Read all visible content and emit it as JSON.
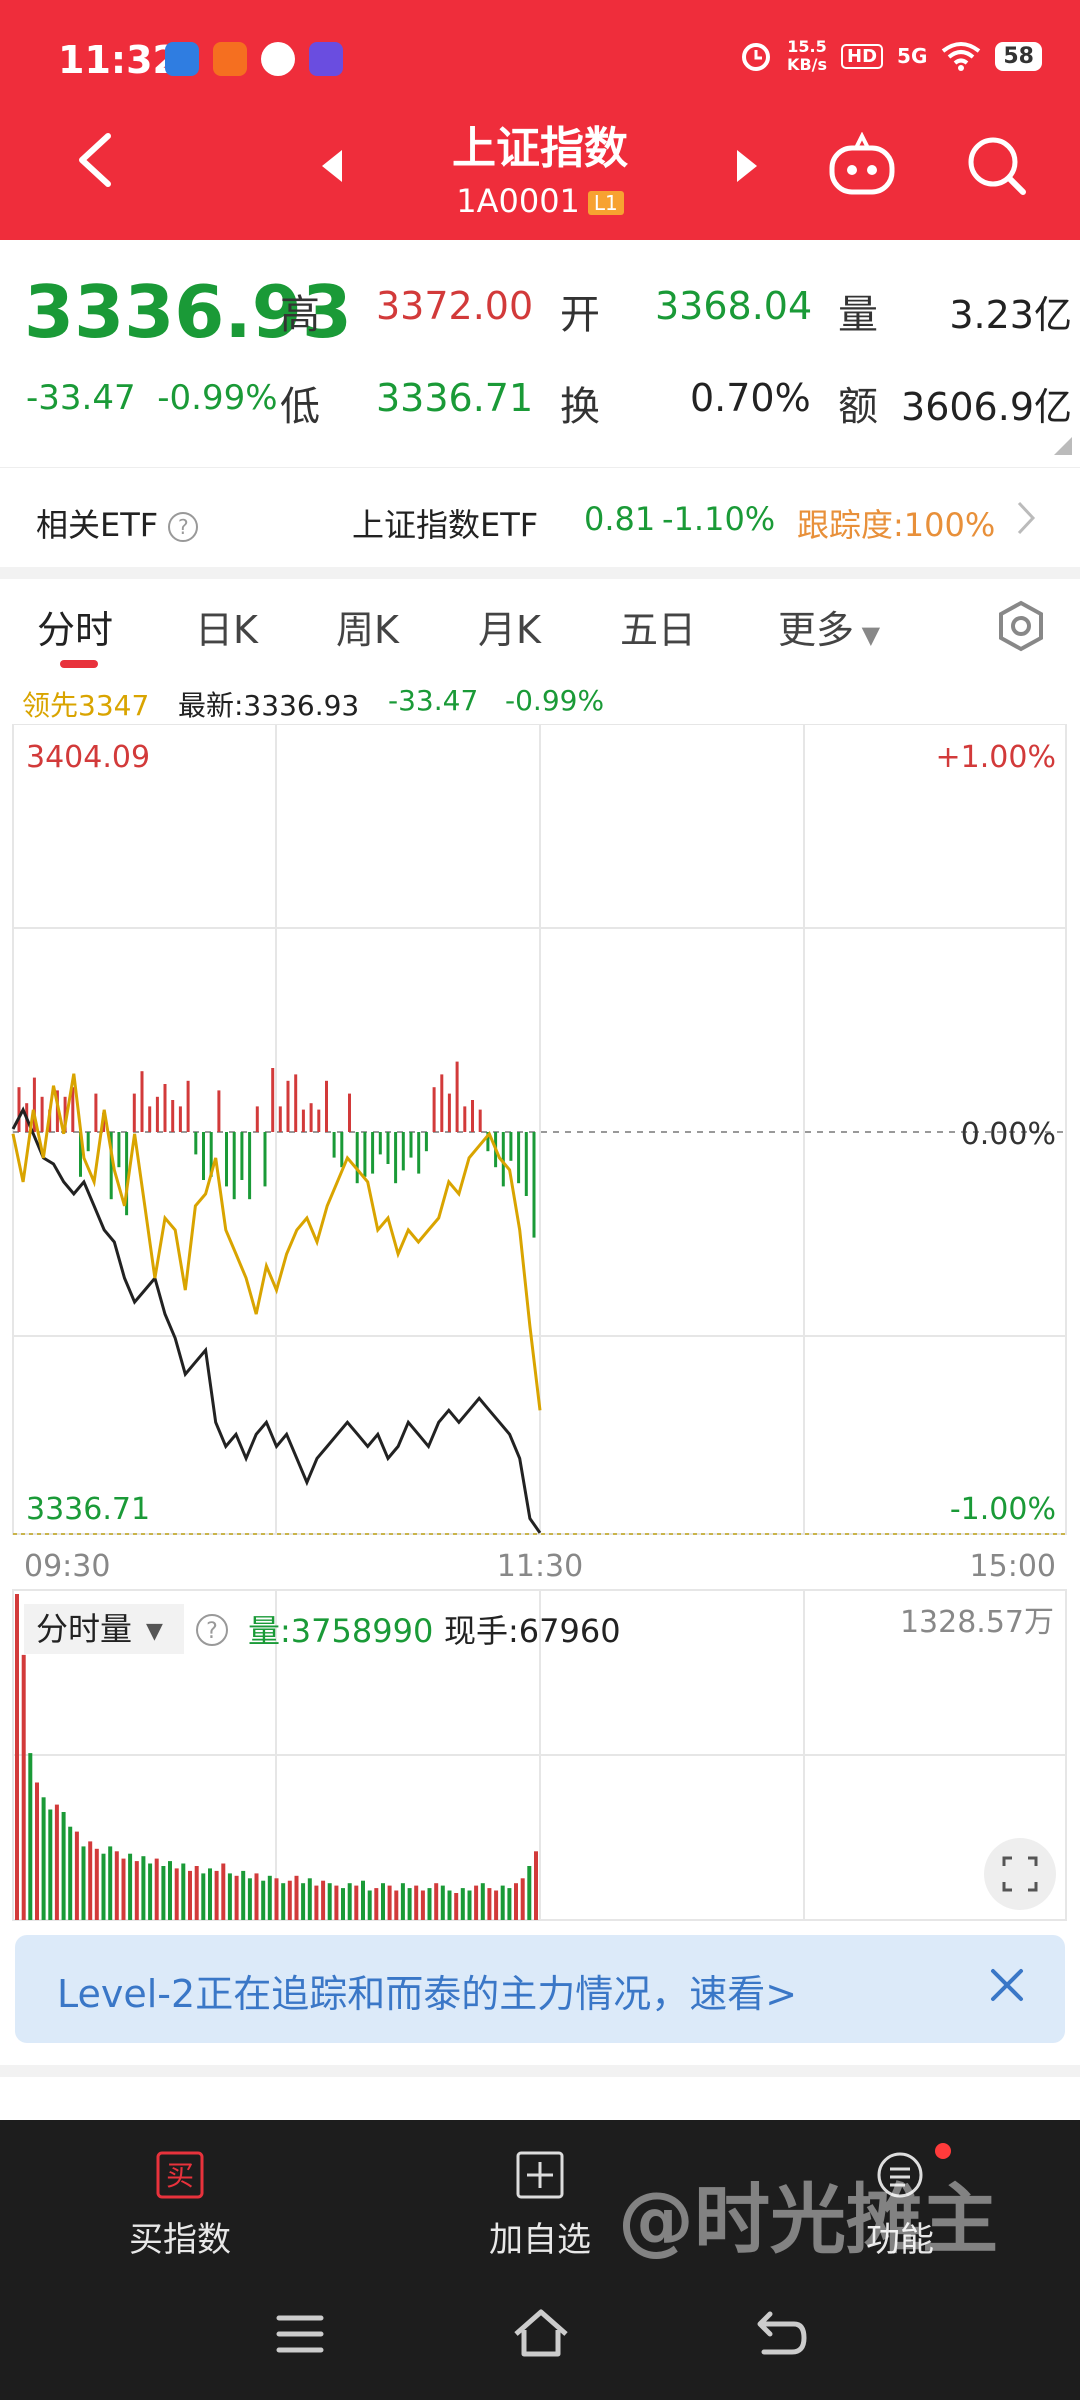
{
  "status_bar": {
    "time": "11:32",
    "net_speed_value": "15.5",
    "net_speed_unit": "KB/s",
    "hd": "HD",
    "signal": "5G",
    "battery": "58"
  },
  "header": {
    "title": "上证指数",
    "code": "1A0001",
    "level_badge": "L1"
  },
  "quote": {
    "price": "3336.93",
    "change": "-33.47",
    "change_pct": "-0.99%",
    "high_label": "高",
    "high_value": "3372.00",
    "open_label": "开",
    "open_value": "3368.04",
    "volume_label": "量",
    "volume_value": "3.23亿",
    "low_label": "低",
    "low_value": "3336.71",
    "turnover_label": "换",
    "turnover_value": "0.70%",
    "amount_label": "额",
    "amount_value": "3606.9亿"
  },
  "etf": {
    "label": "相关ETF",
    "help": "?",
    "name": "上证指数ETF",
    "price": "0.81",
    "change_pct": "-1.10%",
    "tracking": "跟踪度:100%"
  },
  "tabs": [
    {
      "label": "分时"
    },
    {
      "label": "日K"
    },
    {
      "label": "周K"
    },
    {
      "label": "月K"
    },
    {
      "label": "五日"
    },
    {
      "label": "更多"
    }
  ],
  "info": {
    "lead": "领先3347",
    "latest": "最新:3336.93",
    "change": "-33.47",
    "change_pct": "-0.99%"
  },
  "chart_data": {
    "type": "line",
    "y_top_label": "3404.09",
    "y_bottom_label": "3336.71",
    "pct_top_label": "+1.00%",
    "pct_mid_label": "0.00%",
    "pct_bottom_label": "-1.00%",
    "x_labels": [
      "09:30",
      "11:30",
      "15:00"
    ],
    "ylim": [
      3336.71,
      3404.09
    ],
    "prev_close": 3370.4,
    "series": [
      {
        "color": "#222222",
        "values": [
          3370.4,
          3372,
          3370,
          3368,
          3367.5,
          3366,
          3365,
          3366,
          3364,
          3362,
          3361,
          3358,
          3356,
          3357,
          3358,
          3355,
          3353,
          3350,
          3351,
          3352,
          3346,
          3344,
          3345,
          3343,
          3345,
          3346,
          3344,
          3345,
          3343,
          3341,
          3343,
          3344,
          3345,
          3346,
          3345,
          3344,
          3345,
          3343,
          3344,
          3346,
          3345,
          3344,
          3346,
          3347,
          3346,
          3347,
          3348,
          3347,
          3346,
          3345,
          3343,
          3338,
          3336.8
        ]
      },
      {
        "color": "#d9a400",
        "values": [
          3370,
          3366,
          3372,
          3368,
          3374,
          3370,
          3375,
          3368,
          3366,
          3372,
          3367,
          3364,
          3370,
          3364,
          3358,
          3363,
          3362,
          3357,
          3364,
          3365,
          3368,
          3362,
          3360,
          3358,
          3355,
          3359,
          3357,
          3360,
          3362,
          3363,
          3361,
          3364,
          3366,
          3368,
          3367,
          3366,
          3362,
          3363,
          3360,
          3362,
          3361,
          3362,
          3363,
          3366,
          3365,
          3368,
          3369,
          3370,
          3368,
          3367,
          3362,
          3354,
          3347
        ]
      }
    ],
    "bars": [
      2.8,
      1.8,
      3.4,
      2.2,
      1.4,
      2.6,
      2.2,
      2.8,
      -2.8,
      -1.2,
      2.4,
      1.2,
      -4.2,
      -2.2,
      -5.2,
      2.4,
      3.8,
      1.6,
      2.2,
      3,
      2,
      1.6,
      3.2,
      -1.4,
      -3,
      -2.8,
      2.6,
      -3.4,
      -4.2,
      -3,
      -4.2,
      1.6,
      -3.4,
      4,
      1.6,
      3.2,
      3.6,
      1.4,
      1.8,
      1.4,
      3.2,
      -1.6,
      -2.2,
      2.4,
      -3.2,
      -2.8,
      -2.6,
      -1.4,
      -2,
      -3.2,
      -2.4,
      -1.6,
      -2.6,
      -1.2,
      2.8,
      3.6,
      2.4,
      4.4,
      1.6,
      2,
      1.4,
      -1.2,
      -2.2,
      -3.4,
      -1.8,
      -3.2,
      -4,
      -6.6
    ],
    "volume_title": "分时量",
    "volume_help": "?",
    "volume_total": "量:3758990",
    "volume_current": "现手:67960",
    "volume_max_label": "1328.57万",
    "volumes": [
      1328,
      1080,
      680,
      560,
      500,
      450,
      470,
      440,
      380,
      360,
      300,
      320,
      290,
      270,
      300,
      280,
      250,
      270,
      240,
      260,
      230,
      250,
      220,
      240,
      210,
      230,
      200,
      220,
      190,
      210,
      200,
      230,
      190,
      180,
      200,
      170,
      190,
      160,
      180,
      170,
      150,
      160,
      180,
      150,
      170,
      140,
      160,
      150,
      140,
      130,
      150,
      140,
      160,
      120,
      130,
      150,
      140,
      120,
      150,
      130,
      140,
      120,
      130,
      150,
      140,
      120,
      110,
      130,
      120,
      140,
      150,
      130,
      120,
      140,
      130,
      150,
      170,
      220,
      280
    ]
  },
  "banner": {
    "text": "Level-2正在追踪和而泰的主力情况，速看>"
  },
  "toolbar": {
    "buy_icon": "买",
    "buy_label": "买指数",
    "add_label": "加自选",
    "func_label": "功能",
    "watermark": "@时光摊主"
  }
}
